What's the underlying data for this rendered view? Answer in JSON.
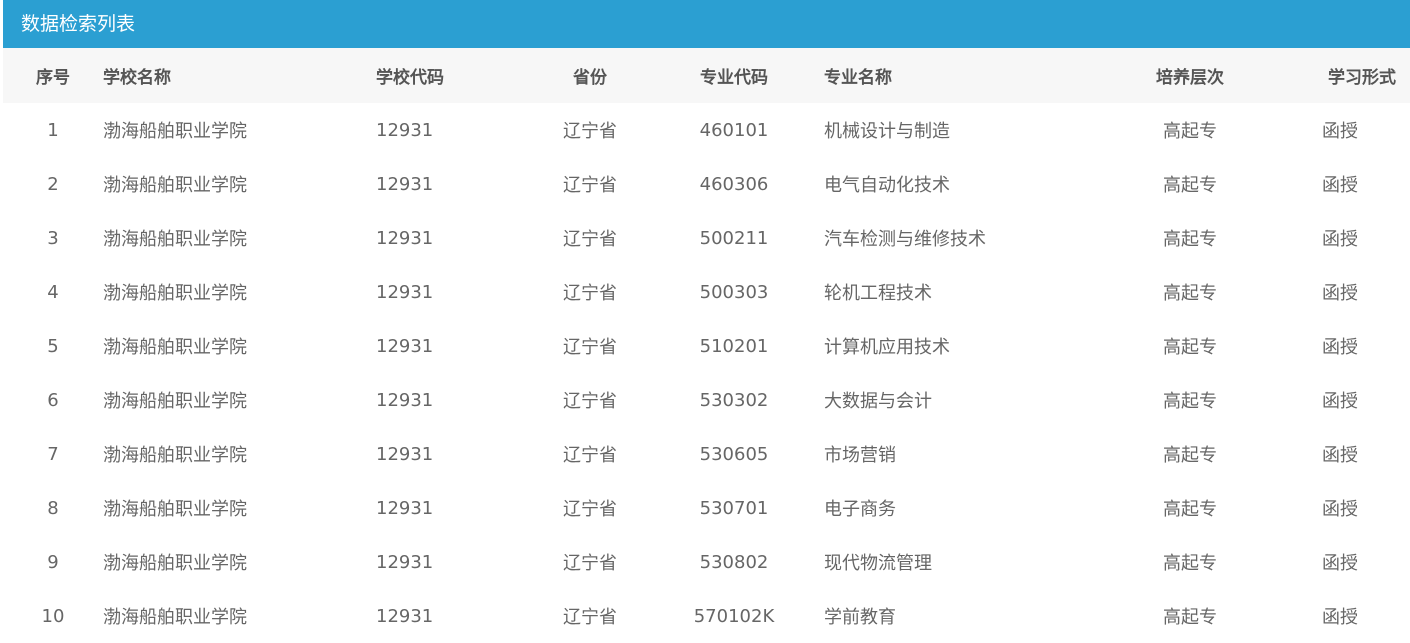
{
  "panel": {
    "title": "数据检索列表"
  },
  "columns": [
    "序号",
    "学校名称",
    "学校代码",
    "省份",
    "专业代码",
    "专业名称",
    "培养层次",
    "学习形式"
  ],
  "rows": [
    [
      "1",
      "渤海船舶职业学院",
      "12931",
      "辽宁省",
      "460101",
      "机械设计与制造",
      "高起专",
      "函授"
    ],
    [
      "2",
      "渤海船舶职业学院",
      "12931",
      "辽宁省",
      "460306",
      "电气自动化技术",
      "高起专",
      "函授"
    ],
    [
      "3",
      "渤海船舶职业学院",
      "12931",
      "辽宁省",
      "500211",
      "汽车检测与维修技术",
      "高起专",
      "函授"
    ],
    [
      "4",
      "渤海船舶职业学院",
      "12931",
      "辽宁省",
      "500303",
      "轮机工程技术",
      "高起专",
      "函授"
    ],
    [
      "5",
      "渤海船舶职业学院",
      "12931",
      "辽宁省",
      "510201",
      "计算机应用技术",
      "高起专",
      "函授"
    ],
    [
      "6",
      "渤海船舶职业学院",
      "12931",
      "辽宁省",
      "530302",
      "大数据与会计",
      "高起专",
      "函授"
    ],
    [
      "7",
      "渤海船舶职业学院",
      "12931",
      "辽宁省",
      "530605",
      "市场营销",
      "高起专",
      "函授"
    ],
    [
      "8",
      "渤海船舶职业学院",
      "12931",
      "辽宁省",
      "530701",
      "电子商务",
      "高起专",
      "函授"
    ],
    [
      "9",
      "渤海船舶职业学院",
      "12931",
      "辽宁省",
      "530802",
      "现代物流管理",
      "高起专",
      "函授"
    ],
    [
      "10",
      "渤海船舶职业学院",
      "12931",
      "辽宁省",
      "570102K",
      "学前教育",
      "高起专",
      "函授"
    ]
  ],
  "colors": {
    "header_bg": "#2b9fd2",
    "table_head_bg": "#f7f7f7"
  }
}
